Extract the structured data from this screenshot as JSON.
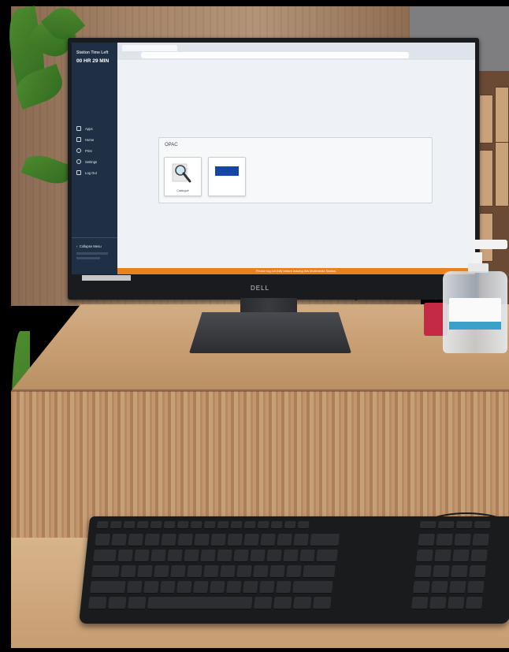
{
  "screen": {
    "sidebar": {
      "station_title": "Station Time Left",
      "time_left": "00 HR 29 MIN",
      "menu_items": [
        {
          "label": "Apps",
          "icon": "grid-icon"
        },
        {
          "label": "Home",
          "icon": "home-icon"
        },
        {
          "label": "Print",
          "icon": "printer-icon"
        },
        {
          "label": "Settings",
          "icon": "gear-icon"
        },
        {
          "label": "Log Out",
          "icon": "logout-icon"
        }
      ],
      "collapse_label": "Collapse Menu"
    },
    "page": {
      "section_title": "OPAC",
      "tiles": [
        {
          "caption": "Catalogue",
          "icon": "magnifier-icon"
        },
        {
          "caption": "",
          "icon": "blue-logo"
        }
      ]
    },
    "banner_text": "Please log out fully before leaving this Multimedia Station."
  },
  "monitor_brand": "DELL"
}
